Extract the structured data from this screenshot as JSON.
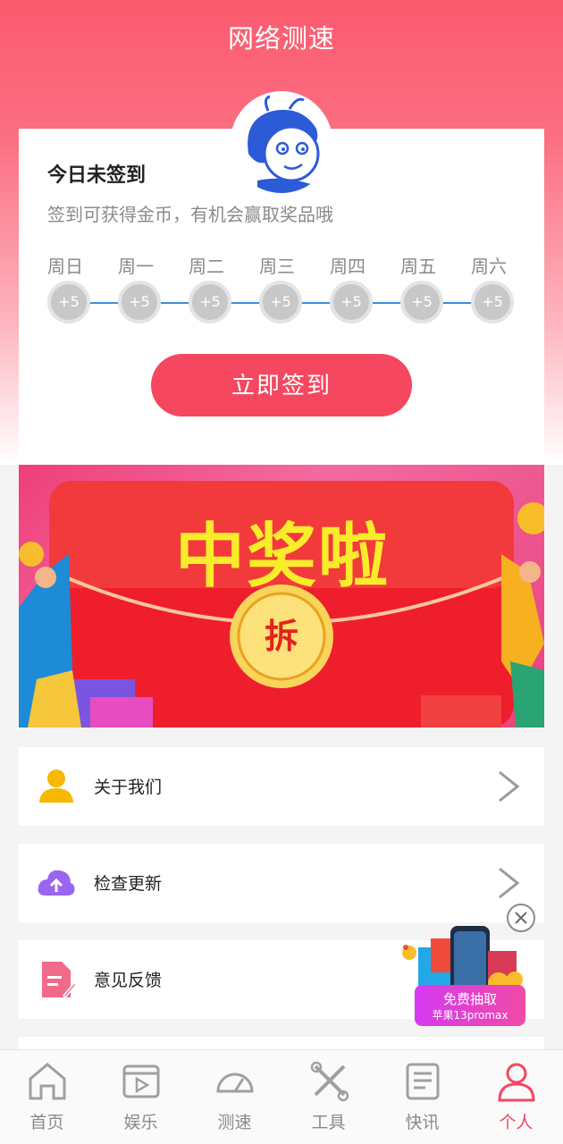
{
  "header": {
    "title": "网络测速"
  },
  "checkin": {
    "title": "今日未签到",
    "subtitle": "签到可获得金币，有机会赢取奖品哦",
    "days": [
      {
        "label": "周日",
        "reward": "+5"
      },
      {
        "label": "周一",
        "reward": "+5"
      },
      {
        "label": "周二",
        "reward": "+5"
      },
      {
        "label": "周三",
        "reward": "+5"
      },
      {
        "label": "周四",
        "reward": "+5"
      },
      {
        "label": "周五",
        "reward": "+5"
      },
      {
        "label": "周六",
        "reward": "+5"
      }
    ],
    "button_label": "立即签到"
  },
  "banner": {
    "title": "中奖啦",
    "button": "拆"
  },
  "menu": [
    {
      "label": "关于我们",
      "icon": "user-icon"
    },
    {
      "label": "检查更新",
      "icon": "cloud-upload-icon"
    },
    {
      "label": "意见反馈",
      "icon": "feedback-icon"
    }
  ],
  "float_ad": {
    "line1": "免费抽取",
    "line2": "苹果13promax"
  },
  "nav": {
    "items": [
      {
        "label": "首页",
        "icon": "home-icon"
      },
      {
        "label": "娱乐",
        "icon": "video-icon"
      },
      {
        "label": "测速",
        "icon": "speedometer-icon"
      },
      {
        "label": "工具",
        "icon": "tools-icon"
      },
      {
        "label": "快讯",
        "icon": "news-icon"
      },
      {
        "label": "个人",
        "icon": "person-icon"
      }
    ],
    "active": "个人"
  },
  "colors": {
    "accent": "#f5475f",
    "header_gradient_top": "#fb5a6e",
    "day_dot": "#c8c8c8",
    "day_line": "#3a8fdc",
    "user_icon": "#f6b800",
    "cloud_icon": "#9a66f0",
    "feedback_icon": "#f06a8a"
  }
}
